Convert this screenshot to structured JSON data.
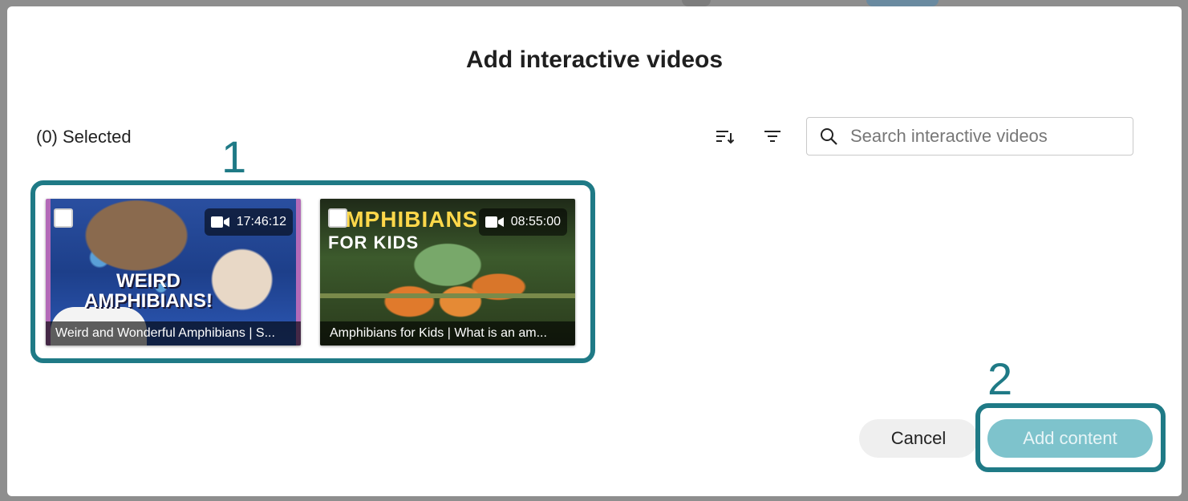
{
  "dialog": {
    "title": "Add interactive videos",
    "selected_count": "(0) Selected"
  },
  "toolbar": {
    "sort_icon": "sort-icon",
    "filter_icon": "filter-icon",
    "search_placeholder": "Search interactive videos"
  },
  "annotations": {
    "marker_1": "1",
    "marker_2": "2",
    "highlight_color": "#1f7a86"
  },
  "videos": [
    {
      "thumbnail_text": "WEIRD AMPHIBIANS!",
      "duration": "17:46:12",
      "title": "Weird and Wonderful Amphibians | S..."
    },
    {
      "thumbnail_text_1": "AMPHIBIANS",
      "thumbnail_text_2": "FOR KIDS",
      "duration": "08:55:00",
      "title": "Amphibians for Kids | What is an am..."
    }
  ],
  "footer": {
    "cancel_label": "Cancel",
    "add_label": "Add content",
    "add_disabled": true,
    "add_color": "#7ec3cc"
  }
}
